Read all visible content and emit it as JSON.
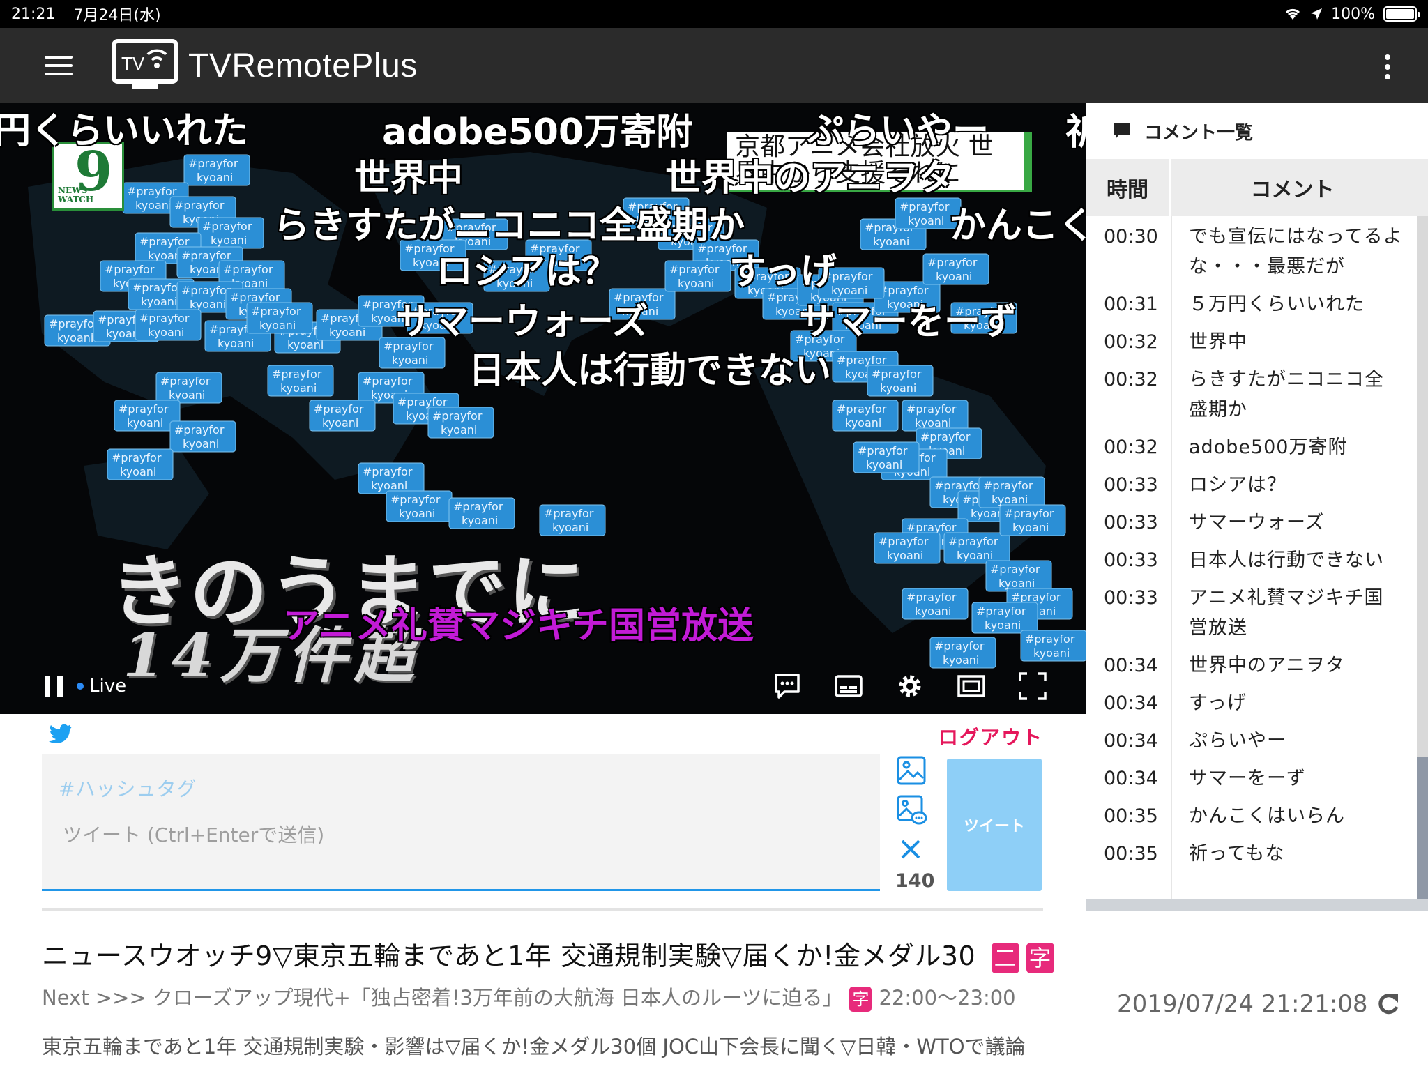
{
  "status": {
    "time": "21:21",
    "date": "7月24日(水)",
    "battery": "100%",
    "battery_level": 1.0
  },
  "app": {
    "title": "TVRemotePlus",
    "logo_text": "TV"
  },
  "video": {
    "channel_logo": {
      "top": "9",
      "bottom": "NEWS WATCH"
    },
    "news_caption": "京都アニメ会社放火 世界中から支援それに",
    "big_caption_1": "きのうまでに",
    "big_caption_2": "14万件超",
    "live_label": "Live",
    "danmaku": [
      {
        "text": "円くらいいれた",
        "purple": false
      },
      {
        "text": "adobe500万寄附",
        "purple": false
      },
      {
        "text": "ぷらいやー",
        "purple": false
      },
      {
        "text": "祈",
        "purple": false
      },
      {
        "text": "世界中",
        "purple": false
      },
      {
        "text": "世界中のアニヲタ",
        "purple": false
      },
      {
        "text": "らきすたがニコニコ全盛期か",
        "purple": false
      },
      {
        "text": "かんこく",
        "purple": false
      },
      {
        "text": "ロシアは？",
        "purple": false
      },
      {
        "text": "すっげ",
        "purple": false
      },
      {
        "text": "サマーウォーズ",
        "purple": false
      },
      {
        "text": "サマーをーず",
        "purple": false
      },
      {
        "text": "日本人は行動できない",
        "purple": false
      },
      {
        "text": "アニメ礼賛マジキチ国営放送",
        "purple": true
      }
    ],
    "tag_top": "#prayfor",
    "tag_bottom": "kyoani"
  },
  "comments": {
    "header": "コメント一覧",
    "col_time": "時間",
    "col_comment": "コメント",
    "rows": [
      {
        "time": "00:30",
        "text": "でも宣伝にはなってるよな・・・最悪だが"
      },
      {
        "time": "00:31",
        "text": "５万円くらいいれた"
      },
      {
        "time": "00:32",
        "text": "世界中"
      },
      {
        "time": "00:32",
        "text": "らきすたがニコニコ全盛期か"
      },
      {
        "time": "00:32",
        "text": "adobe500万寄附"
      },
      {
        "time": "00:33",
        "text": "ロシアは？"
      },
      {
        "time": "00:33",
        "text": "サマーウォーズ"
      },
      {
        "time": "00:33",
        "text": "日本人は行動できない"
      },
      {
        "time": "00:33",
        "text": "アニメ礼賛マジキチ国営放送"
      },
      {
        "time": "00:34",
        "text": "世界中のアニヲタ"
      },
      {
        "time": "00:34",
        "text": "すっげ"
      },
      {
        "time": "00:34",
        "text": "ぷらいやー"
      },
      {
        "time": "00:34",
        "text": "サマーをーず"
      },
      {
        "time": "00:35",
        "text": "かんこくはいらん"
      },
      {
        "time": "00:35",
        "text": "祈ってもな"
      }
    ]
  },
  "tweet": {
    "logout": "ログアウト",
    "hashtag_placeholder": "#ハッシュタグ",
    "placeholder": "ツイート (Ctrl+Enterで送信)",
    "count": "140",
    "button": "ツイート"
  },
  "program": {
    "title": "ニュースウオッチ9▽東京五輪まであと1年 交通規制実験▽届くか!金メダル30",
    "badge_1": "二",
    "badge_2": "字",
    "next_prefix": "Next >>> クローズアップ現代+「独占密着!3万年前の大航海 日本人のルーツに迫る」",
    "next_badge": "字",
    "next_time": "22:00～23:00",
    "datetime": "2019/07/24 21:21:08",
    "description": "東京五輪まであと1年 交通規制実験・影響は▽届くか!金メダル30個 JOC山下会長に聞く▽日韓・WTOで議論"
  },
  "colors": {
    "accent_pink": "#e72a7b",
    "logout_red": "#e5175b",
    "tweet_blue": "#2196e8",
    "tag_blue": "#2b8fd6",
    "danmaku_purple": "#c21bd6"
  }
}
